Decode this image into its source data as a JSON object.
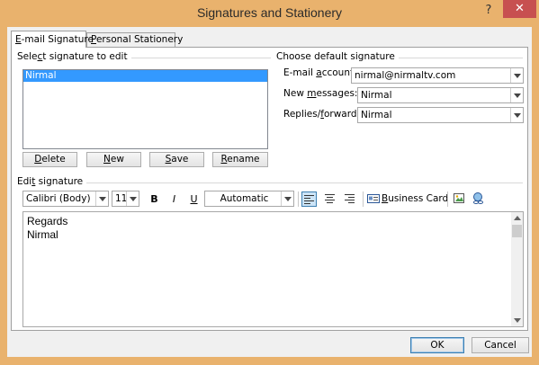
{
  "window": {
    "title": "Signatures and Stationery",
    "help_glyph": "?",
    "close_glyph": "✕"
  },
  "tabs": [
    {
      "pre": "",
      "key": "E",
      "post": "-mail Signature",
      "active": true
    },
    {
      "pre": "",
      "key": "P",
      "post": "ersonal Stationery",
      "active": false
    }
  ],
  "select_section": {
    "title_pre": "Sele",
    "title_key": "c",
    "title_post": "t signature to edit",
    "items": [
      "Nirmal"
    ],
    "selected": "Nirmal"
  },
  "buttons": {
    "delete": {
      "pre": "",
      "key": "D",
      "post": "elete"
    },
    "new": {
      "pre": "",
      "key": "N",
      "post": "ew"
    },
    "save": {
      "pre": "",
      "key": "S",
      "post": "ave"
    },
    "rename": {
      "pre": "",
      "key": "R",
      "post": "ename"
    }
  },
  "default_section": {
    "title": "Choose default signature",
    "email_label_pre": "E-mail ",
    "email_label_key": "a",
    "email_label_post": "ccount:",
    "email_value": "nirmal@nirmaltv.com",
    "new_label_pre": "New ",
    "new_label_key": "m",
    "new_label_post": "essages:",
    "new_value": "Nirmal",
    "reply_label_pre": "Replies/",
    "reply_label_key": "f",
    "reply_label_post": "orwards:",
    "reply_value": "Nirmal"
  },
  "edit_section": {
    "title_pre": "Edi",
    "title_key": "t",
    "title_post": " signature",
    "font": "Calibri (Body)",
    "size": "11",
    "bold": "B",
    "italic": "I",
    "underline": "U",
    "color": "Automatic",
    "business_card_pre": "",
    "business_card_key": "B",
    "business_card_post": "usiness Card",
    "body_lines": [
      "Regards",
      "Nirmal"
    ]
  },
  "footer": {
    "ok": "OK",
    "cancel": "Cancel"
  },
  "colors": {
    "titlebar": "#e9b26d",
    "close": "#c75050",
    "selection": "#3399ff"
  }
}
